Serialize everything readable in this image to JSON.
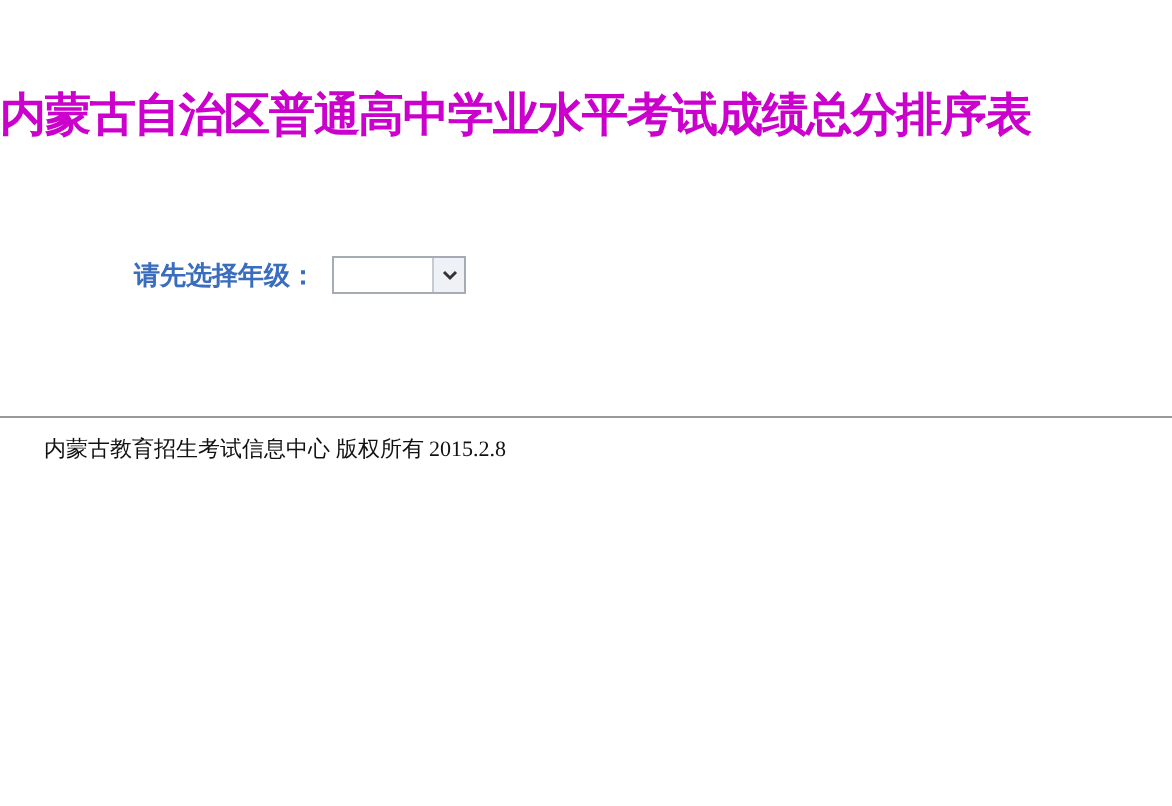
{
  "title": "内蒙古自治区普通高中学业水平考试成绩总分排序表",
  "grade_select": {
    "label": "请先选择年级："
  },
  "footer": "内蒙古教育招生考试信息中心 版权所有 2015.2.8"
}
